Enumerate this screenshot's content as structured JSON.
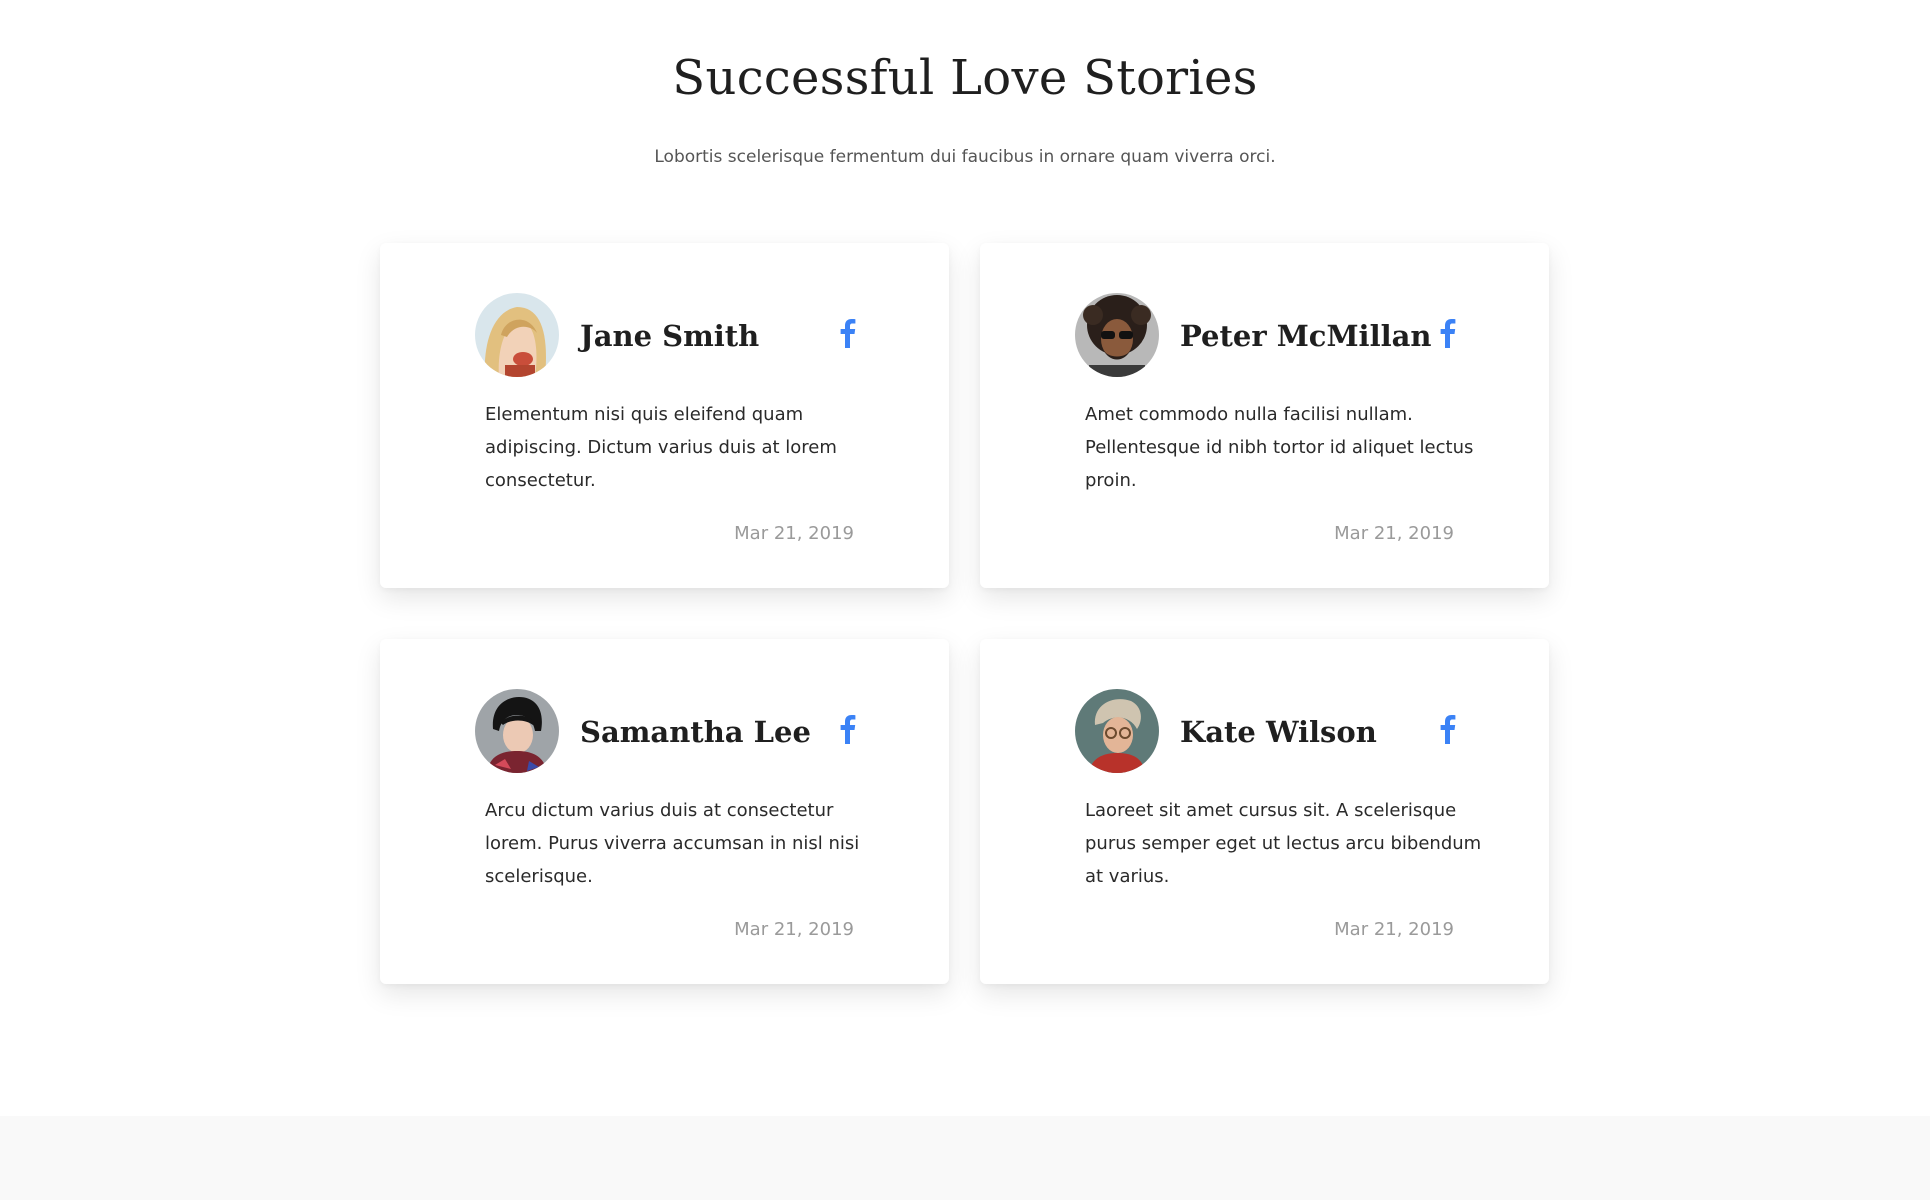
{
  "header": {
    "title": "Successful Love Stories",
    "subtitle": "Lobortis scelerisque fermentum dui faucibus in ornare quam viverra orci."
  },
  "stories": [
    {
      "name": "Jane Smith",
      "text": "Elementum nisi quis eleifend quam adipiscing. Dictum varius duis at lorem consectetur.",
      "date": "Mar 21, 2019",
      "social_icon": "facebook-icon"
    },
    {
      "name": "Peter McMillan",
      "text": "Amet commodo nulla facilisi nullam. Pellentesque id nibh tortor id aliquet lectus proin.",
      "date": "Mar 21, 2019",
      "social_icon": "facebook-icon"
    },
    {
      "name": "Samantha Lee",
      "text": "Arcu dictum varius duis at consectetur lorem. Purus viverra accumsan in nisl nisi scelerisque.",
      "date": "Mar 21, 2019",
      "social_icon": "facebook-icon"
    },
    {
      "name": "Kate Wilson",
      "text": "Laoreet sit amet cursus sit. A scelerisque purus semper eget ut lectus arcu bibendum at varius.",
      "date": "Mar 21, 2019",
      "social_icon": "facebook-icon"
    }
  ],
  "colors": {
    "accent": "#3b82f6",
    "title": "#1f1f1f",
    "body_text": "#2a2a2a",
    "muted": "#9a9a9a",
    "footer_band": "#f9f9f9"
  }
}
